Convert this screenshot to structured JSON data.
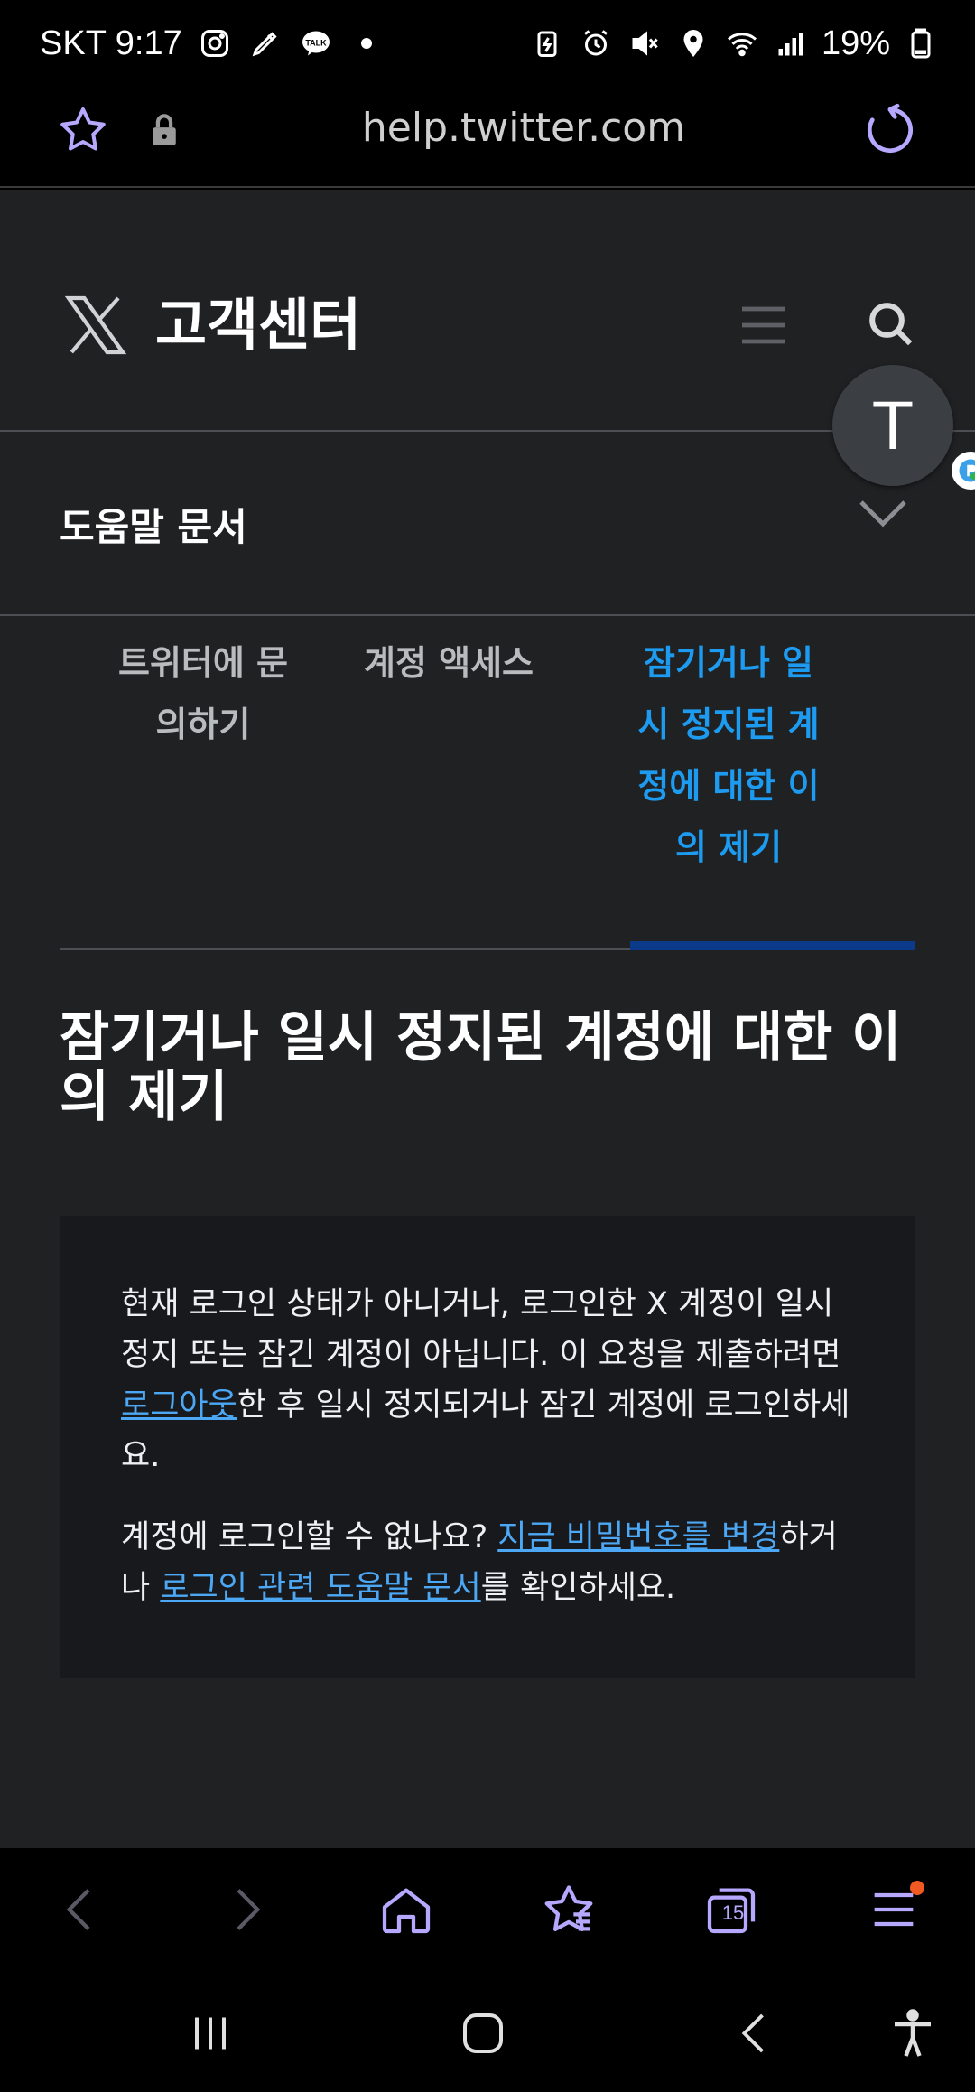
{
  "status_bar": {
    "carrier_time": "SKT 9:17",
    "battery": "19%",
    "left_icons": [
      "instagram-icon",
      "pen-app-icon",
      "kakaotalk-icon",
      "dot-icon"
    ],
    "kakao_label": "TALK",
    "right_icons": [
      "battery-saver-icon",
      "alarm-icon",
      "mute-icon",
      "location-icon",
      "wifi-icon",
      "signal-icon",
      "battery-icon"
    ]
  },
  "browser": {
    "url": "help.twitter.com",
    "tab_count": "15",
    "accent": "#b7a8ff"
  },
  "header": {
    "title": "고객센터",
    "avatar_letter": "T"
  },
  "docs": {
    "label": "도움말 문서"
  },
  "breadcrumbs": [
    {
      "label": "트위터에 문의하기",
      "active": false
    },
    {
      "label": "계정 액세스",
      "active": false
    },
    {
      "label": "잠기거나 일시 정지된 계정에 대한 이의 제기",
      "active": true
    }
  ],
  "article": {
    "title": "잠기거나 일시 정지된 계정에 대한 이의 제기"
  },
  "notice": {
    "p1_before": "현재 로그인 상태가 아니거나, 로그인한 X 계정이 일시 정지 또는 잠긴 계정이 아닙니다. 이 요청을 제출하려면 ",
    "p1_link": "로그아웃",
    "p1_after": "한 후 일시 정지되거나 잠긴 계정에 로그인하세요.",
    "p2_before": "계정에 로그인할 수 없나요? ",
    "p2_link1": "지금 비밀번호를 변경",
    "p2_mid": "하거나 ",
    "p2_link2": "로그인 관련 도움말 문서",
    "p2_after": "를 확인하세요."
  },
  "colors": {
    "link": "#4ca8f5",
    "active_crumb": "#1d9bf0",
    "page_bg": "#202123"
  }
}
